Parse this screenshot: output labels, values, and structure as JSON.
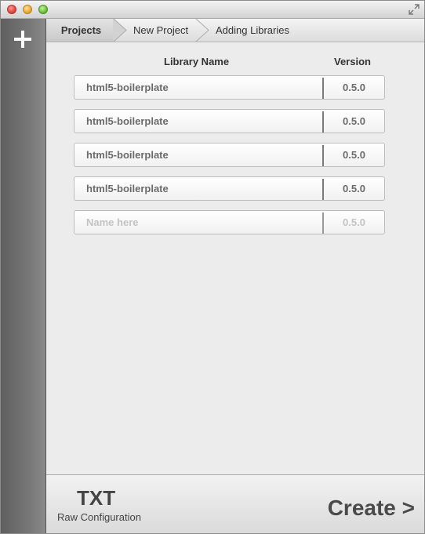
{
  "breadcrumb": {
    "items": [
      "Projects",
      "New Project",
      "Adding Libraries"
    ]
  },
  "table": {
    "headers": {
      "name": "Library Name",
      "version": "Version"
    },
    "rows": [
      {
        "name": "html5-boilerplate",
        "version": "0.5.0"
      },
      {
        "name": "html5-boilerplate",
        "version": "0.5.0"
      },
      {
        "name": "html5-boilerplate",
        "version": "0.5.0"
      },
      {
        "name": "html5-boilerplate",
        "version": "0.5.0"
      }
    ],
    "new_row": {
      "name_placeholder": "Name here",
      "version_placeholder": "0.5.0"
    }
  },
  "footer": {
    "raw_title": "TXT",
    "raw_subtitle": "Raw Configuration",
    "create_label": "Create >"
  },
  "icons": {
    "window_close": "close-icon",
    "window_minimize": "minimize-icon",
    "window_zoom": "zoom-icon",
    "fullscreen": "fullscreen-icon",
    "add": "plus-icon"
  },
  "colors": {
    "traffic_red": "#e0443c",
    "traffic_yellow": "#e9a935",
    "traffic_green": "#6cbf3b",
    "sidebar": "#6d6d6d",
    "text_muted": "#6b6b6b"
  }
}
